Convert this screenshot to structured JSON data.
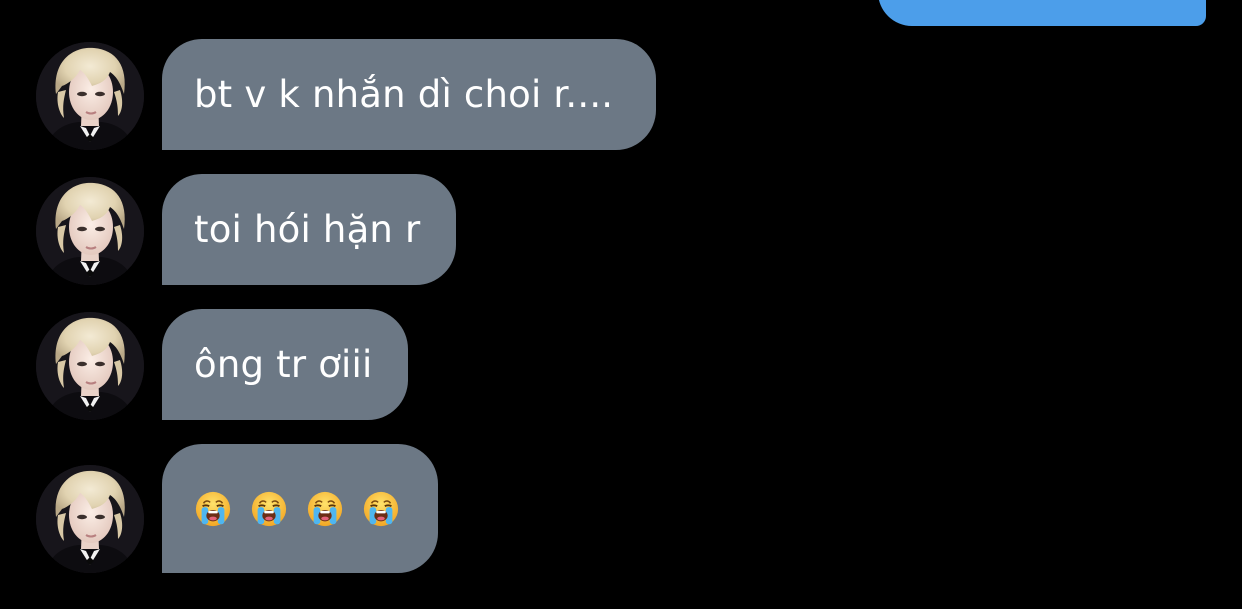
{
  "colors": {
    "background": "#000000",
    "incoming_bubble": "#6c7885",
    "outgoing_bubble": "#4c9eea",
    "text": "#ffffff"
  },
  "messages": [
    {
      "direction": "incoming",
      "text": "bt v k nhắn dì choi r...."
    },
    {
      "direction": "incoming",
      "text": "toi hói hặn r"
    },
    {
      "direction": "incoming",
      "text": "ông tr ơiii"
    },
    {
      "direction": "incoming",
      "emojis": [
        "loudly-crying-face",
        "loudly-crying-face",
        "loudly-crying-face",
        "loudly-crying-face"
      ]
    }
  ],
  "avatar_icon": "contact-avatar-photo"
}
